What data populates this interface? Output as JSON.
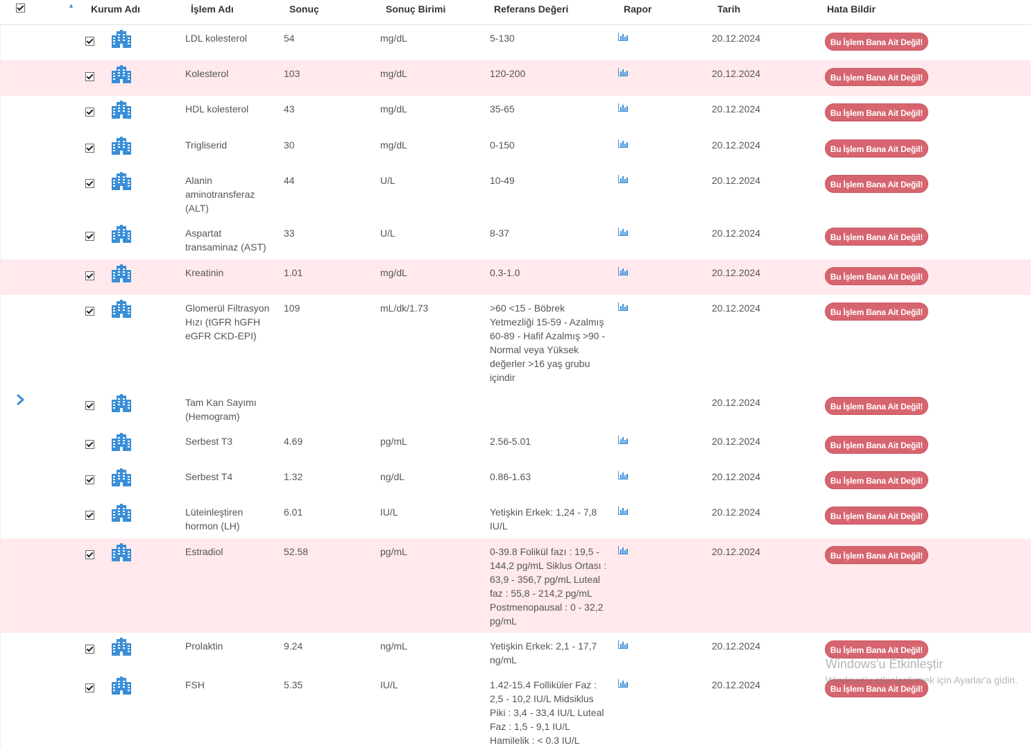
{
  "header": {
    "kurum": "Kurum Adı",
    "islem": "İşlem Adı",
    "sonuc": "Sonuç",
    "birim": "Sonuç Birimi",
    "referans": "Referans Değeri",
    "rapor": "Rapor",
    "tarih": "Tarih",
    "hata": "Hata Bildir"
  },
  "report_button_label": "Bu İşlem Bana Ait Değil!",
  "icons": {
    "institution": "hospital-building-icon",
    "report": "bar-chart-icon",
    "expand": "chevron-right-icon"
  },
  "colors": {
    "accent": "#3a8ed8",
    "button": "#d7656f",
    "highlight_row": "#ffe9ec"
  },
  "rows": [
    {
      "name": "LDL kolesterol",
      "result": "54",
      "unit": "mg/dL",
      "ref": "5-130",
      "date": "20.12.2024",
      "highlight": false,
      "report": true
    },
    {
      "name": "Kolesterol",
      "result": "103",
      "unit": "mg/dL",
      "ref": "120-200",
      "date": "20.12.2024",
      "highlight": true,
      "report": true
    },
    {
      "name": "HDL kolesterol",
      "result": "43",
      "unit": "mg/dL",
      "ref": "35-65",
      "date": "20.12.2024",
      "highlight": false,
      "report": true
    },
    {
      "name": "Trigliserid",
      "result": "30",
      "unit": "mg/dL",
      "ref": "0-150",
      "date": "20.12.2024",
      "highlight": false,
      "report": true
    },
    {
      "name": "Alanin aminotransferaz (ALT)",
      "result": "44",
      "unit": "U/L",
      "ref": "10-49",
      "date": "20.12.2024",
      "highlight": false,
      "report": true
    },
    {
      "name": "Aspartat transaminaz (AST)",
      "result": "33",
      "unit": "U/L",
      "ref": "8-37",
      "date": "20.12.2024",
      "highlight": false,
      "report": true
    },
    {
      "name": "Kreatinin",
      "result": "1.01",
      "unit": "mg/dL",
      "ref": "0.3-1.0",
      "date": "20.12.2024",
      "highlight": true,
      "report": true
    },
    {
      "name": "Glomerül Filtrasyon Hızı (tGFR hGFH eGFR CKD-EPI)",
      "result": "109",
      "unit": "mL/dk/1.73",
      "ref": ">60 <15 - Böbrek Yetmezliği 15-59 - Azalmış 60-89 - Hafif Azalmış >90 - Normal veya Yüksek değerler >16 yaş grubu içindir",
      "date": "20.12.2024",
      "highlight": false,
      "report": true
    },
    {
      "name": "Tam Kan Sayımı (Hemogram)",
      "result": "",
      "unit": "",
      "ref": "",
      "date": "20.12.2024",
      "highlight": false,
      "report": false,
      "expand": true
    },
    {
      "name": "Serbest T3",
      "result": "4.69",
      "unit": "pg/mL",
      "ref": "2.56-5.01",
      "date": "20.12.2024",
      "highlight": false,
      "report": true
    },
    {
      "name": "Serbest T4",
      "result": "1.32",
      "unit": "ng/dL",
      "ref": "0.86-1.63",
      "date": "20.12.2024",
      "highlight": false,
      "report": true
    },
    {
      "name": "Lüteinleştiren hormon (LH)",
      "result": "6.01",
      "unit": "IU/L",
      "ref": "Yetişkin Erkek: 1,24 - 7,8 IU/L",
      "date": "20.12.2024",
      "highlight": false,
      "report": true
    },
    {
      "name": "Estradiol",
      "result": "52.58",
      "unit": "pg/mL",
      "ref": "0-39.8 Folikül fazı : 19,5 - 144,2 pg/mL Siklus Ortası : 63,9 - 356,7 pg/mL Luteal faz : 55,8 - 214,2 pg/mL Postmenopausal : 0 - 32,2 pg/mL",
      "date": "20.12.2024",
      "highlight": true,
      "report": true
    },
    {
      "name": "Prolaktin",
      "result": "9.24",
      "unit": "ng/mL",
      "ref": "Yetişkin Erkek: 2,1 - 17,7 ng/mL",
      "date": "20.12.2024",
      "highlight": false,
      "report": true
    },
    {
      "name": "FSH",
      "result": "5.35",
      "unit": "IU/L",
      "ref": "1.42-15.4 Folliküler Faz : 2,5 - 10,2 IU/L Midsiklus Piki : 3,4 - 33,4 IU/L Luteal Faz : 1,5 - 9,1 IU/L Hamilelik : < 0.3 IU/L",
      "date": "20.12.2024",
      "highlight": false,
      "report": true
    }
  ],
  "watermark": {
    "title": "Windows'u Etkinleştir",
    "subtitle": "Windows'u etkinleştirmek için Ayarlar'a gidin."
  }
}
